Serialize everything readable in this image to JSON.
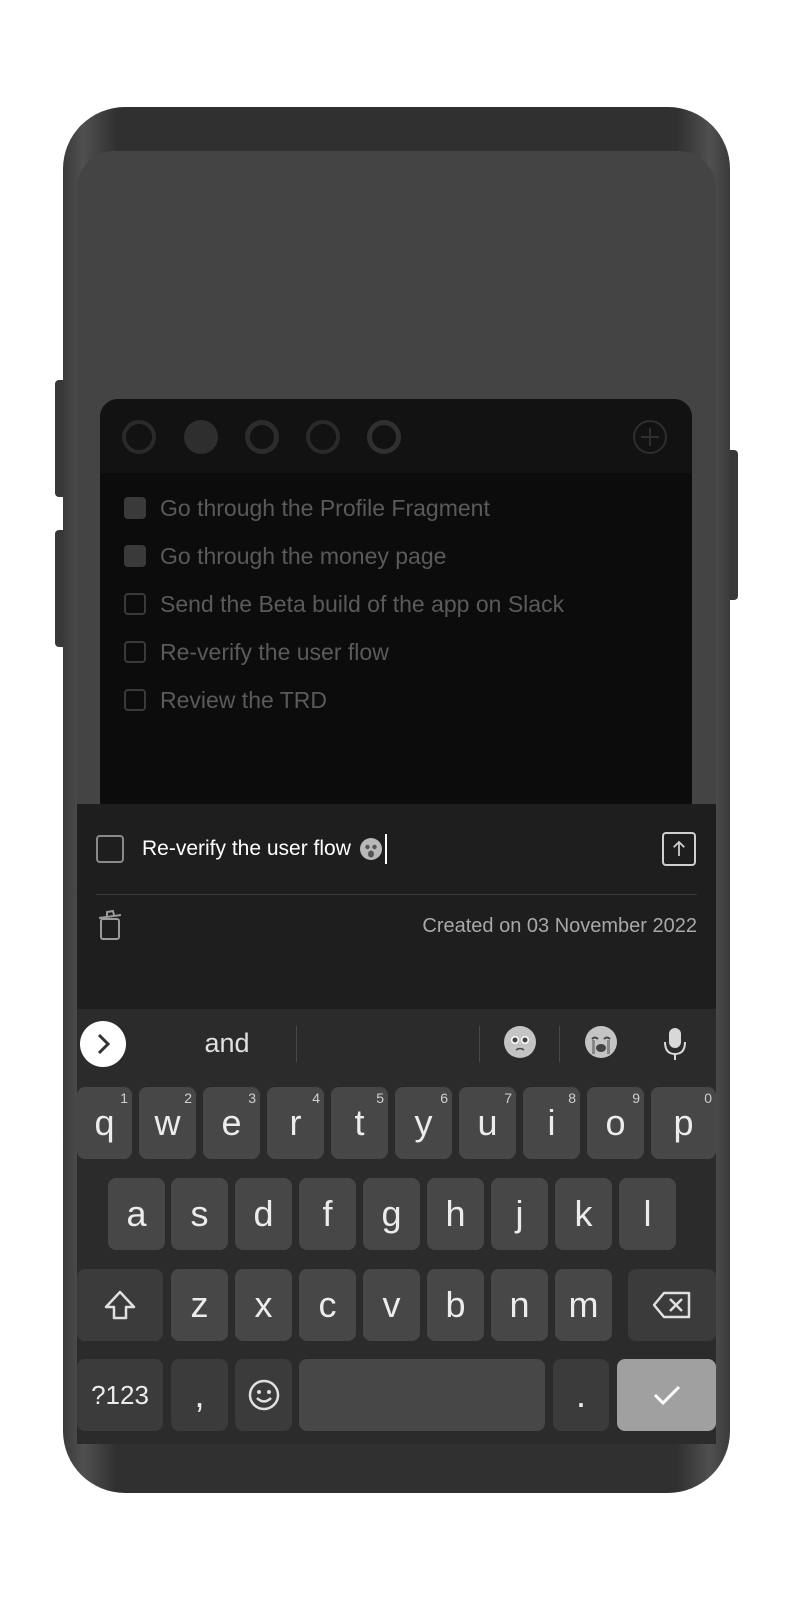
{
  "card": {
    "color_dots": [
      "#2a2a2a",
      "#2e2e2e",
      "#2c2c2c",
      "#2a2a2a",
      "#303030"
    ],
    "add_icon": "plus-circle-icon",
    "tasks": [
      {
        "label": "Go through the Profile Fragment",
        "checked": true
      },
      {
        "label": "Go through the money page",
        "checked": true
      },
      {
        "label": "Send the Beta build of the app on Slack",
        "checked": false
      },
      {
        "label": "Re-verify the user flow",
        "checked": false
      },
      {
        "label": "Review the TRD",
        "checked": false
      }
    ]
  },
  "editor": {
    "task_text": "Re-verify the user flow",
    "task_emoji": "face-screaming-icon",
    "created_text": "Created on 03 November 2022",
    "upload_icon": "upload-icon",
    "delete_icon": "trash-icon"
  },
  "keyboard": {
    "suggestion": "and",
    "suggestion_emojis": [
      "pleading-face-icon",
      "crying-face-icon"
    ],
    "row1": [
      {
        "key": "q",
        "hint": "1"
      },
      {
        "key": "w",
        "hint": "2"
      },
      {
        "key": "e",
        "hint": "3"
      },
      {
        "key": "r",
        "hint": "4"
      },
      {
        "key": "t",
        "hint": "5"
      },
      {
        "key": "y",
        "hint": "6"
      },
      {
        "key": "u",
        "hint": "7"
      },
      {
        "key": "i",
        "hint": "8"
      },
      {
        "key": "o",
        "hint": "9"
      },
      {
        "key": "p",
        "hint": "0"
      }
    ],
    "row2": [
      "a",
      "s",
      "d",
      "f",
      "g",
      "h",
      "j",
      "k",
      "l"
    ],
    "row3": [
      "z",
      "x",
      "c",
      "v",
      "b",
      "n",
      "m"
    ],
    "symbols_label": "?123",
    "comma_label": ",",
    "period_label": "."
  },
  "colors": {
    "screen_bg": "#444444",
    "card_bg": "#0c0c0c",
    "sheet_bg": "#1e1e1e",
    "keyboard_bg": "#2b2b2b",
    "key_bg": "#474747",
    "enter_key_bg": "#a0a0a0"
  }
}
